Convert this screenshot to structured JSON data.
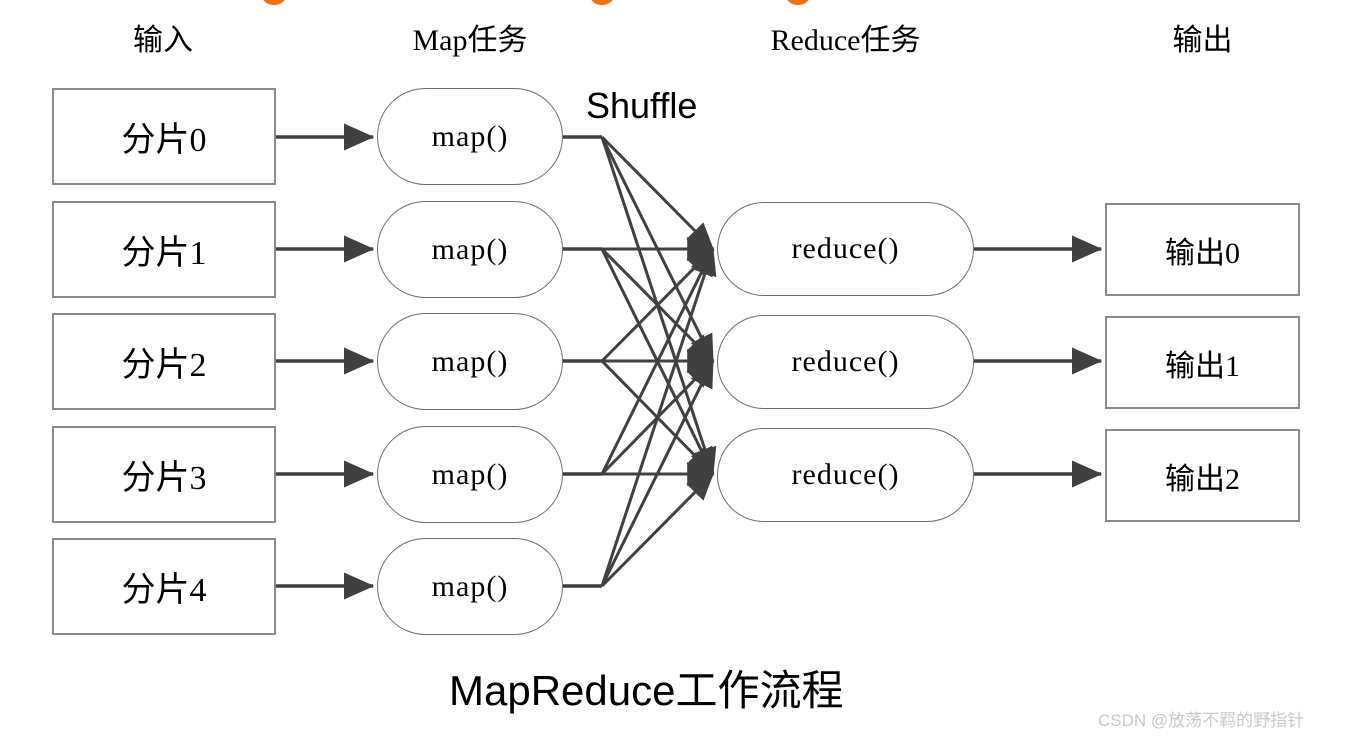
{
  "diagram": {
    "title_latin": "MapReduce",
    "title_han": "工作流程",
    "shuffle_label": "Shuffle",
    "watermark": "CSDN @放荡不羁的野指针",
    "colors": {
      "rect_border": "#8a8a8a",
      "pill_border": "#6e6e6e",
      "arrow": "#404040",
      "text": "#000000",
      "watermark": "#c9c9c9",
      "background": "#ffffff",
      "orange_crumb": "#e8761f"
    }
  },
  "columns": [
    {
      "id": "input",
      "label": "输入"
    },
    {
      "id": "map",
      "label": "Map任务"
    },
    {
      "id": "reduce",
      "label": "Reduce任务"
    },
    {
      "id": "output",
      "label": "输出"
    }
  ],
  "inputs": [
    {
      "label": "分片0"
    },
    {
      "label": "分片1"
    },
    {
      "label": "分片2"
    },
    {
      "label": "分片3"
    },
    {
      "label": "分片4"
    }
  ],
  "maps": [
    {
      "label": "map()"
    },
    {
      "label": "map()"
    },
    {
      "label": "map()"
    },
    {
      "label": "map()"
    },
    {
      "label": "map()"
    }
  ],
  "reduces": [
    {
      "label": "reduce()"
    },
    {
      "label": "reduce()"
    },
    {
      "label": "reduce()"
    }
  ],
  "outputs": [
    {
      "label": "输出0"
    },
    {
      "label": "输出1"
    },
    {
      "label": "输出2"
    }
  ]
}
